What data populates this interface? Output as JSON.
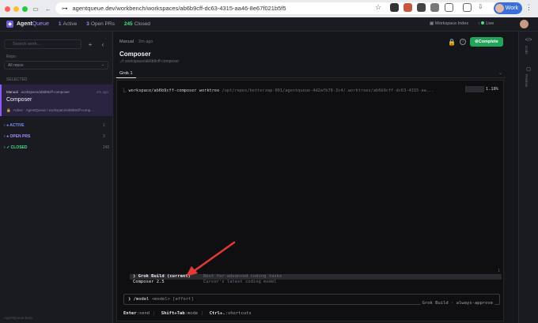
{
  "browser": {
    "url": "agentqueue.dev/workbench/workspaces/ab6b9cff-dc63-4315-aa46-8e67f021b5f5",
    "profile_label": "Work",
    "colors": {
      "close": "#ff5f57",
      "minimize": "#febc2e",
      "maximize": "#28c840"
    }
  },
  "app": {
    "brand_prefix": "Agent",
    "brand_suffix": "Queue",
    "stats": {
      "active_count": "1",
      "active_label": "Active",
      "open_count": "3",
      "open_label": "Open PRs",
      "closed_count": "245",
      "closed_label": "Closed"
    },
    "workspace_index": "Workspace Index",
    "live_label": "Live"
  },
  "sidebar": {
    "search_placeholder": "Search work...",
    "repo_label": "Repo",
    "repo_value": "All repos",
    "selected_label": "SELECTED",
    "selected_item": {
      "tag": "Manual",
      "branch": "workspace/ab6b9cff-composer",
      "time": "2m ago",
      "name": "Composer",
      "status": "Active",
      "path": "AgentQueue / workspace/ab6b9cff-comp..."
    },
    "groups": [
      {
        "label": "● ACTIVE",
        "count": "1",
        "color": "#7c8cf6"
      },
      {
        "label": "● OPEN PRS",
        "count": "3",
        "color": "#a78bfa"
      },
      {
        "label": "✓ CLOSED",
        "count": "245",
        "color": "#4ade80"
      }
    ],
    "footer": "AgentQueue Beta"
  },
  "main": {
    "crumb_tag": "Manual",
    "crumb_ago": "2m ago",
    "title": "Composer",
    "path": "⎇ workspace/ab6b9cff-composer",
    "complete_label": "Complete",
    "tab_label": "Grok 1"
  },
  "terminal": {
    "line_prefix": "⎿ workspace/ab6b9cff-composer worktree",
    "line_path": "/opt/repos/betterzap-001/agentqueue-4d2afb78-3c4/.worktrees/ab6b9cff-dc63-4315-aa...",
    "progress_pct": "1.18%",
    "progress_value": 0.0118,
    "scroll_badge": "1",
    "menu": [
      {
        "label": "❯ Grok Build",
        "current": "(current)",
        "desc": "Best for advanced coding tasks",
        "selected": true
      },
      {
        "label": "Composer 2.5",
        "current": "",
        "desc": "Cursor's latest coding model",
        "selected": false
      }
    ],
    "input_cmd": "❯ /model",
    "input_args": "<model> [effort]",
    "input_model": "Grok Build · always-approve",
    "hints": [
      {
        "key": "Enter",
        "text": ":send"
      },
      {
        "key": "Shift+Tab",
        "text": ":mode"
      },
      {
        "key": "Ctrl+.",
        "text": ":shortcuts"
      }
    ]
  },
  "rail": {
    "code_label": "Code",
    "preview_label": "Preview"
  }
}
